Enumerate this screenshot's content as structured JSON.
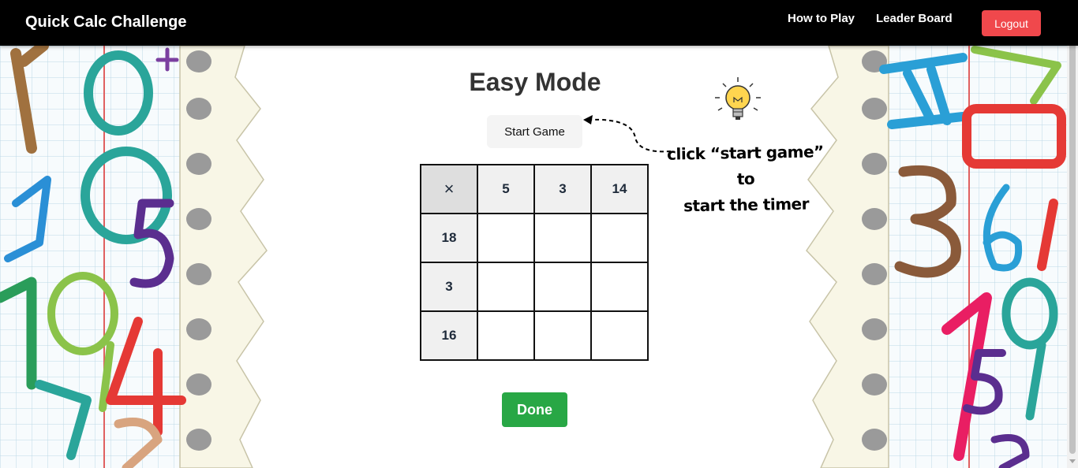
{
  "app": {
    "title": "Quick Calc Challenge"
  },
  "nav": {
    "how_to_play": "How to Play",
    "leader_board": "Leader Board",
    "logout": "Logout"
  },
  "game": {
    "title": "Easy Mode",
    "start_button": "Start Game",
    "hint_line1": "click “start game” to",
    "hint_line2": "start the timer",
    "operator": "×",
    "columns": [
      "5",
      "3",
      "14"
    ],
    "rows": [
      "18",
      "3",
      "16"
    ],
    "done_button": "Done"
  },
  "colors": {
    "navbar": "#000000",
    "logout": "#f0484c",
    "done": "#28a745"
  },
  "icons": [
    "lightbulb-icon",
    "dashed-arrow-icon"
  ]
}
